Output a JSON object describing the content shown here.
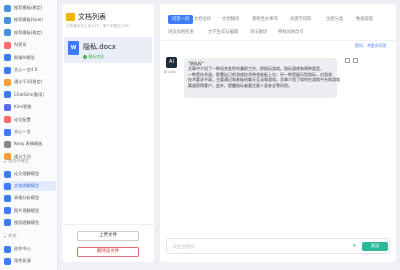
{
  "nav": {
    "items": [
      {
        "label": "推荐模板(稳定)",
        "color": "#4a90e2"
      },
      {
        "label": "推荐模板(Sale)",
        "color": "#4a90e2"
      },
      {
        "label": "推荐模板(稳定)",
        "color": "#4a90e2"
      },
      {
        "label": "AI资讯",
        "color": "#ff6b6b"
      },
      {
        "label": "智聊AI模型",
        "color": "#3d7bf7"
      },
      {
        "label": "文心一言4.0",
        "color": "#3d7bf7"
      },
      {
        "label": "通义千问(稳定)",
        "color": "#ff9a3c"
      },
      {
        "label": "ChatGlm(备用)",
        "color": "#3d7bf7"
      },
      {
        "label": "Kimi智能",
        "color": "#5b6bf0"
      },
      {
        "label": "论文配置",
        "color": "#ff6b6b"
      },
      {
        "label": "文心一言",
        "color": "#3d7bf7"
      },
      {
        "label": "Keep 表情模板",
        "color": "#888888"
      },
      {
        "label": "通义千问",
        "color": "#ff9a3c"
      }
    ],
    "section_doc": "我的AI模型",
    "doc_items": [
      {
        "label": "论文理解模型",
        "color": "#3d7bf7"
      },
      {
        "label": "文档理解模型",
        "color": "#3d7bf7",
        "active": true
      },
      {
        "label": "表格分析模型",
        "color": "#3d7bf7"
      },
      {
        "label": "图片理解模型",
        "color": "#3d7bf7"
      },
      {
        "label": "视频理解模型",
        "color": "#3d7bf7"
      }
    ],
    "section_more": "其他",
    "bottom_items": [
      {
        "label": "创作中心",
        "color": "#3d7bf7"
      },
      {
        "label": "角色扮演",
        "color": "#3d7bf7"
      }
    ]
  },
  "file_panel": {
    "title": "文档列表",
    "subtitle": "文件最多可上传10个，单个不超过10M",
    "file_name": "隐私.docx",
    "doc_icon": "W",
    "file_status": "解析完成",
    "upload_label": "上传文件",
    "delete_label": "删除该文件"
  },
  "main": {
    "tabs": [
      {
        "label": "问答一问",
        "active": true
      },
      {
        "label": "文档总结"
      },
      {
        "label": "文档翻译"
      },
      {
        "label": "重要性办事项"
      },
      {
        "label": "关键字提取"
      },
      {
        "label": "主题分类"
      },
      {
        "label": "数据提取"
      },
      {
        "label": "语法风格检查"
      },
      {
        "label": "文字生成与编辑"
      },
      {
        "label": "语法翻译"
      },
      {
        "label": "特殊风格改写"
      }
    ],
    "links": [
      "提问",
      "#图文问答"
    ],
    "avatar": "AI",
    "avatar_caption": "AI Chat",
    "bubble_lines": [
      "\"隐私权\"",
      "文章中介绍了一种适合女性的兼职工作，即陪玩游戏。陪玩游戏有两种类型，",
      "一种是技术流，即靠自己的游戏技术带领老板上分；另一种是娱乐型陪玩，对游戏",
      "技术要求不高，主要通过和老板的聊天互动和游戏。文章介绍了如何在游戏平台和游戏",
      "渠道获得客户，此外，提醒陪玩者要注意人身安全等风险。"
    ],
    "input_placeholder": "向左业提问...",
    "send_label": "发送"
  }
}
